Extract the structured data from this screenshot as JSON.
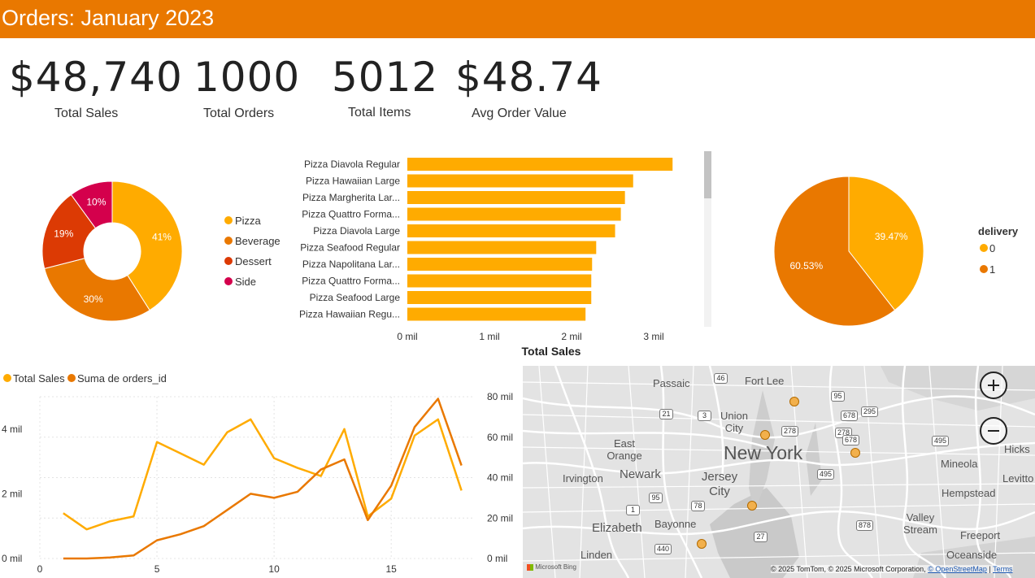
{
  "header": {
    "title": "Orders: January 2023",
    "color": "#e97800"
  },
  "kpis": [
    {
      "value": "$48,740",
      "label": "Total Sales"
    },
    {
      "value": "1000",
      "label": "Total Orders"
    },
    {
      "value": "5012",
      "label": "Total Items"
    },
    {
      "value": "$48.74",
      "label": "Avg Order Value"
    }
  ],
  "chart_data": [
    {
      "type": "pie",
      "variant": "donut",
      "categories": [
        "Pizza",
        "Beverage",
        "Dessert",
        "Side"
      ],
      "values": [
        41,
        30,
        19,
        10
      ],
      "labels": [
        "41%",
        "30%",
        "19%",
        "10%"
      ],
      "colors": [
        "#ffab00",
        "#e97800",
        "#dc3a04",
        "#d4004c"
      ],
      "legend": "right"
    },
    {
      "type": "bar",
      "orientation": "horizontal",
      "categories": [
        "Pizza Diavola Regular",
        "Pizza Hawaiian Large",
        "Pizza Margherita Lar...",
        "Pizza Quattro Forma...",
        "Pizza Diavola Large",
        "Pizza Seafood Regular",
        "Pizza Napolitana Lar...",
        "Pizza Quattro Forma...",
        "Pizza Seafood Large",
        "Pizza Hawaiian Regu..."
      ],
      "values": [
        3230,
        2750,
        2650,
        2600,
        2530,
        2300,
        2250,
        2240,
        2240,
        2170
      ],
      "xlabel": "Total Sales",
      "xticks": [
        "0 mil",
        "1 mil",
        "2 mil",
        "3 mil"
      ],
      "xlim": [
        0,
        3700
      ],
      "color": "#ffab00"
    },
    {
      "type": "pie",
      "title": "delivery",
      "categories": [
        "0",
        "1"
      ],
      "values": [
        39.47,
        60.53
      ],
      "labels": [
        "39.47%",
        "60.53%"
      ],
      "colors": [
        "#ffab00",
        "#e97800"
      ],
      "legend": "right"
    },
    {
      "type": "line",
      "x": [
        1,
        2,
        3,
        4,
        5,
        6,
        7,
        8,
        9,
        10,
        11,
        12,
        13,
        14,
        15,
        16,
        17,
        18
      ],
      "series": [
        {
          "name": "Total Sales",
          "axis": "left",
          "color": "#ffab00",
          "values": [
            1400,
            900,
            1150,
            1300,
            3600,
            3250,
            2900,
            3900,
            4300,
            3100,
            2800,
            2550,
            4000,
            1300,
            1850,
            3800,
            4300,
            2100
          ]
        },
        {
          "name": "Suma de orders_id",
          "axis": "right",
          "color": "#e97800",
          "values": [
            0,
            0,
            0.5,
            1.5,
            9,
            12,
            16,
            24,
            32,
            30,
            33,
            44,
            49,
            19,
            36,
            65,
            79,
            46
          ]
        }
      ],
      "xticks": [
        "0",
        "5",
        "10",
        "15"
      ],
      "xlim": [
        0,
        18.5
      ],
      "yticks_left": [
        "0 mil",
        "2 mil",
        "4 mil"
      ],
      "ylim_left": [
        0,
        5000
      ],
      "yticks_right": [
        "0 mil",
        "20 mil",
        "40 mil",
        "60 mil",
        "80 mil"
      ],
      "ylim_right": [
        0,
        80
      ],
      "legend": "top-left"
    }
  ],
  "map": {
    "places": [
      "Passaic",
      "Fort Lee",
      "Union City",
      "New York",
      "East Orange",
      "Newark",
      "Irvington",
      "Jersey City",
      "Bayonne",
      "Elizabeth",
      "Linden",
      "Mineola",
      "Hempstead",
      "Hicks",
      "Levitto",
      "Valley Stream",
      "Freeport",
      "Oceanside"
    ],
    "road_shields": [
      "46",
      "95",
      "295",
      "678",
      "278",
      "21",
      "3",
      "278",
      "678",
      "495",
      "95",
      "1",
      "78",
      "27",
      "440",
      "878",
      "495"
    ],
    "zoom_in_icon": "plus-icon",
    "zoom_out_icon": "minus-icon",
    "bing_label": "Microsoft Bing",
    "attribution": "© 2025 TomTom, © 2025 Microsoft Corporation, ",
    "osm_link": "© OpenStreetMap",
    "terms_link": "Terms"
  }
}
